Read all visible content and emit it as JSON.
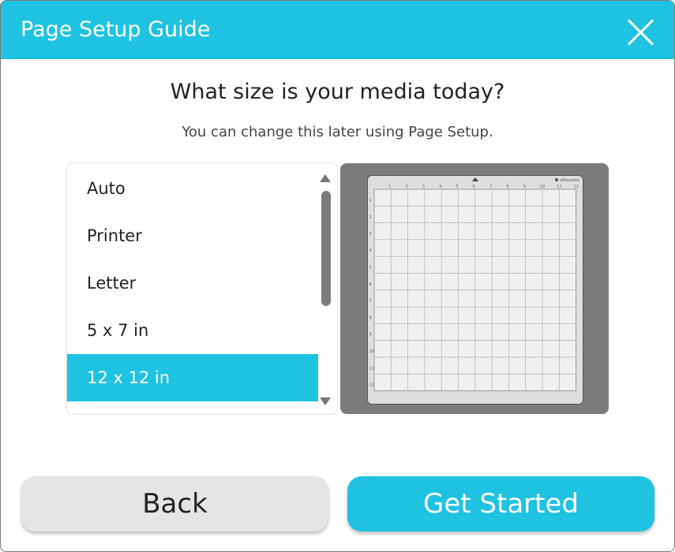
{
  "dialog": {
    "title": "Page Setup Guide",
    "question": "What size is your media today?",
    "subtitle": "You can change this later using Page Setup."
  },
  "sizes": {
    "items": [
      "Auto",
      "Printer",
      "Letter",
      "5 x 7 in",
      "12 x 12 in"
    ],
    "selected": "12 x 12 in"
  },
  "mat_preview": {
    "brand": "silhouette",
    "ruler": [
      "1",
      "2",
      "3",
      "4",
      "5",
      "6",
      "7",
      "8",
      "9",
      "10",
      "11",
      "12"
    ]
  },
  "buttons": {
    "back": "Back",
    "get_started": "Get Started"
  },
  "colors": {
    "accent": "#1fc2e0",
    "preview_bg": "#7b7b7b"
  },
  "icons": {
    "close": "close-icon",
    "scroll_up": "triangle-up-icon",
    "scroll_down": "triangle-down-icon"
  }
}
